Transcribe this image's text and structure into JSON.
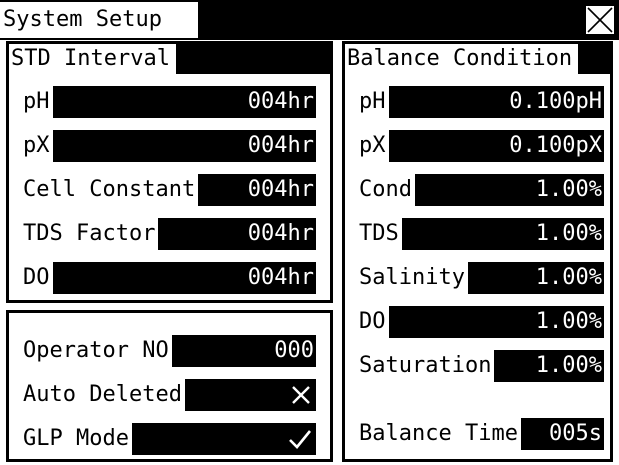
{
  "window": {
    "title": "System Setup",
    "close_icon": "close-x-icon"
  },
  "std_interval": {
    "title": "STD Interval",
    "rows": [
      {
        "label": "pH",
        "value": "004hr"
      },
      {
        "label": "pX",
        "value": "004hr"
      },
      {
        "label": "Cell Constant",
        "value": "004hr"
      },
      {
        "label": "TDS Factor",
        "value": "004hr"
      },
      {
        "label": "DO",
        "value": "004hr"
      }
    ]
  },
  "operator": {
    "operator_no": {
      "label": "Operator NO",
      "value": "000"
    },
    "auto_deleted": {
      "label": "Auto Deleted",
      "state": "off",
      "icon": "cross-icon"
    },
    "glp_mode": {
      "label": "GLP Mode",
      "state": "on",
      "icon": "checkmark-icon"
    }
  },
  "balance": {
    "title": "Balance Condition",
    "rows": [
      {
        "label": "pH",
        "value": "0.100pH"
      },
      {
        "label": "pX",
        "value": "0.100pX"
      },
      {
        "label": "Cond",
        "value": "1.00%"
      },
      {
        "label": "TDS",
        "value": "1.00%"
      },
      {
        "label": "Salinity",
        "value": "1.00%"
      },
      {
        "label": "DO",
        "value": "1.00%"
      },
      {
        "label": "Saturation",
        "value": "1.00%"
      }
    ],
    "balance_time": {
      "label": "Balance Time",
      "value": "005s"
    }
  },
  "colors": {
    "background": "#ffffff",
    "foreground": "#000000"
  }
}
